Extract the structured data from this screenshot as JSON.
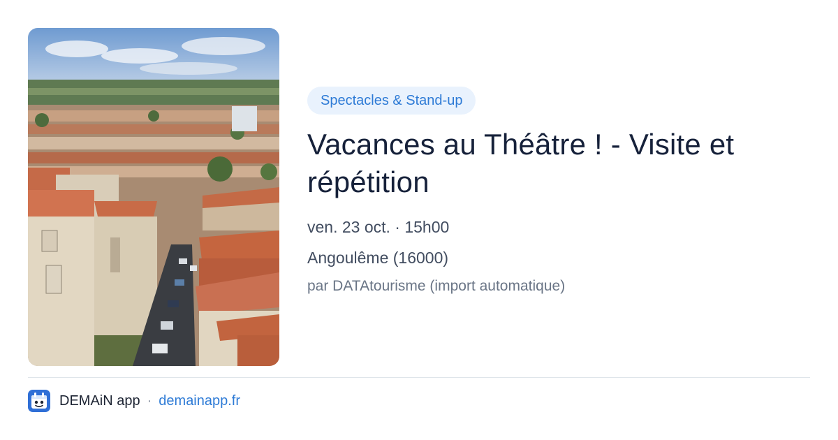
{
  "event": {
    "category": "Spectacles & Stand-up",
    "title": "Vacances au Théâtre ! - Visite et répétition",
    "datetime": "ven. 23 oct. · 15h00",
    "location": "Angoulême (16000)",
    "source": "par DATAtourisme (import automatique)",
    "image_icon": "city-rooftops-photo"
  },
  "footer": {
    "app_name": "DEMAiN app",
    "separator": "·",
    "site": "demainapp.fr",
    "app_icon": "demain-app-icon"
  },
  "colors": {
    "accent": "#2e7bd6",
    "badge_bg": "#e9f2fd",
    "title": "#16213a",
    "meta": "#424d60",
    "muted": "#6a7586",
    "divider": "#dfe5ea"
  }
}
